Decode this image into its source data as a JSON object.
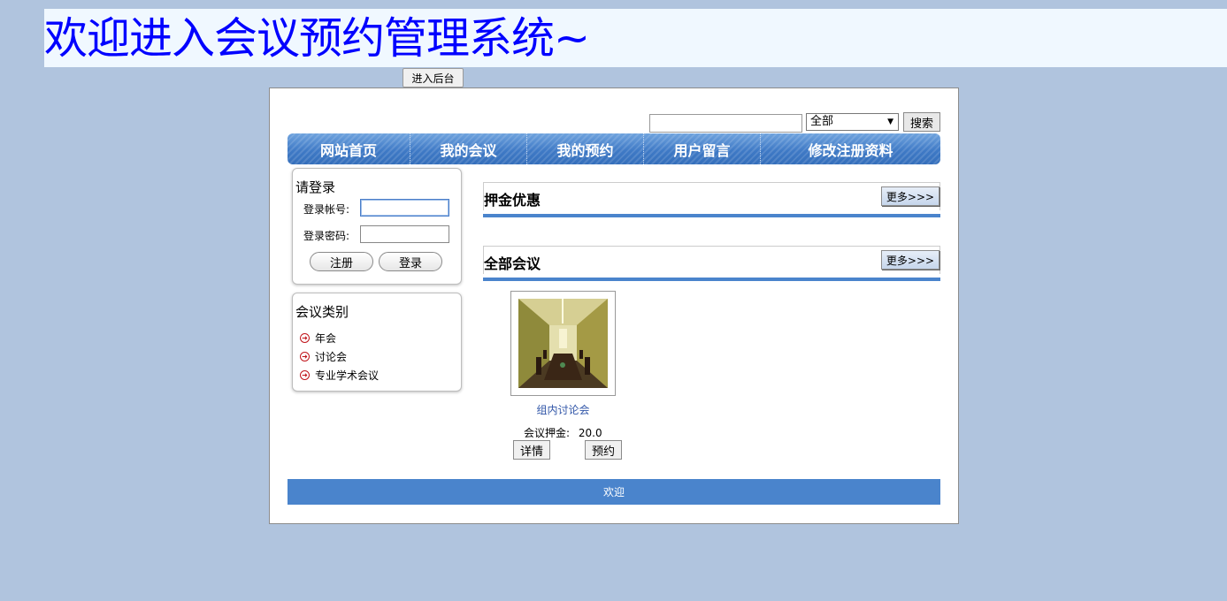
{
  "banner": {
    "title": "欢迎进入会议预约管理系统~"
  },
  "admin_button": "进入后台",
  "search": {
    "input_value": "",
    "select_value": "全部",
    "button_label": "搜索"
  },
  "nav": [
    "网站首页",
    "我的会议",
    "我的预约",
    "用户留言",
    "修改注册资料"
  ],
  "login": {
    "title": "请登录",
    "account_label": "登录帐号:",
    "password_label": "登录密码:",
    "account_value": "",
    "password_value": "",
    "register_label": "注册",
    "login_label": "登录"
  },
  "categories": {
    "title": "会议类别",
    "items": [
      "年会",
      "讨论会",
      "专业学术会议"
    ]
  },
  "sections": {
    "deposit": {
      "title": "押金优惠",
      "more": "更多>>>"
    },
    "all": {
      "title": "全部会议",
      "more": "更多>>>"
    }
  },
  "meetings": [
    {
      "name": "组内讨论会",
      "deposit_label": "会议押金:",
      "deposit_value": "20.0",
      "detail_label": "详情",
      "book_label": "预约"
    }
  ],
  "footer": "欢迎",
  "colors": {
    "page_bg": "#b0c4de",
    "banner_bg": "#f0f8ff",
    "banner_text": "#0000ff",
    "nav_blue": "#3f7ac6",
    "footer_blue": "#4a84cc",
    "link_blue": "#3156a8",
    "bullet_red": "#c0141a"
  },
  "icons": {
    "category_bullet": "arrow-circle-right-icon"
  }
}
